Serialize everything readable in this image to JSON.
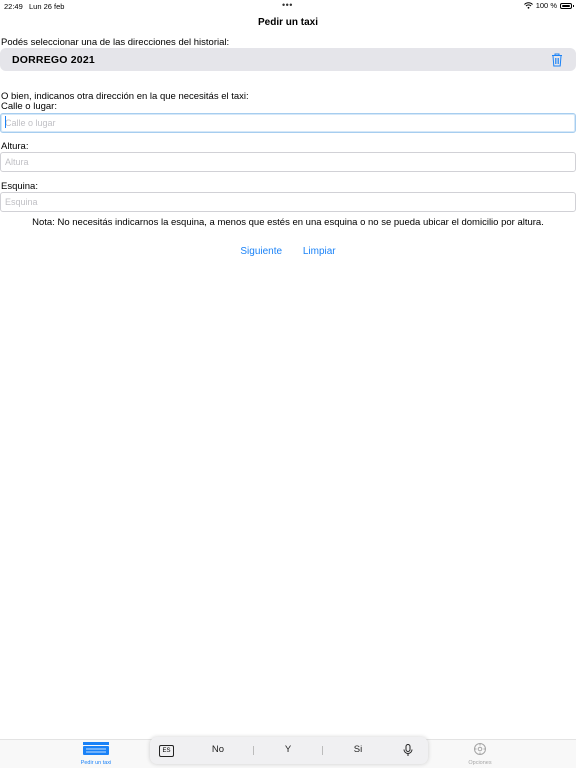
{
  "status_bar": {
    "time": "22:49",
    "date": "Lun 26 feb",
    "battery_text": "100 %",
    "battery_level": 1.0
  },
  "nav": {
    "title": "Pedir un taxi"
  },
  "history": {
    "label": "Podés seleccionar una de las direcciones del historial:",
    "items": [
      {
        "address": "DORREGO 2021",
        "delete_icon": "trash-icon"
      }
    ]
  },
  "other": {
    "label": "O bien, indicanos otra dirección en la que necesitás el taxi:"
  },
  "fields": {
    "street": {
      "label": "Calle o lugar:",
      "placeholder": "Calle o lugar",
      "value": ""
    },
    "number": {
      "label": "Altura:",
      "placeholder": "Altura",
      "value": ""
    },
    "corner": {
      "label": "Esquina:",
      "placeholder": "Esquina",
      "value": ""
    }
  },
  "note": "Nota: No necesitás indicarnos la esquina, a menos que estés en una esquina o no se pueda ubicar el domicilio por altura.",
  "actions": {
    "next": "Siguiente",
    "clear": "Limpiar"
  },
  "tabs": [
    {
      "label": "Pedir un taxi",
      "icon": "taxi-logo-icon",
      "active": true
    },
    {
      "label": "Opciones",
      "icon": "gear-icon",
      "active": false
    }
  ],
  "keyboard": {
    "language": "ES",
    "suggestions": [
      "No",
      "Y",
      "Si"
    ],
    "mic_icon": "microphone-icon"
  },
  "colors": {
    "accent": "#1a82f7",
    "history_bg": "#e5e5ea"
  }
}
